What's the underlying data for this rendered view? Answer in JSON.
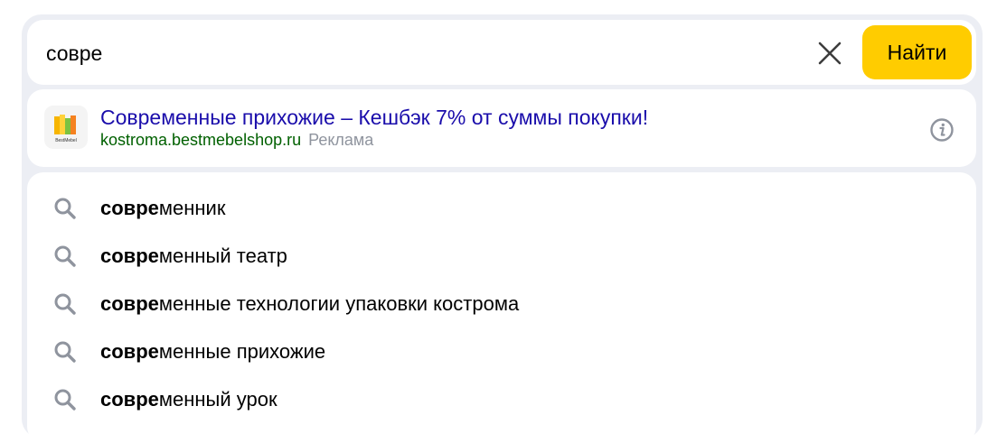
{
  "search": {
    "query": "совре",
    "submit_label": "Найти"
  },
  "ad": {
    "title": "Современные прихожие – Кешбэк 7% от суммы покупки!",
    "domain": "kostroma.bestmebelshop.ru",
    "label": "Реклама",
    "logo_text": "BestMebel"
  },
  "suggestions": [
    {
      "prefix": "совре",
      "rest": "менник"
    },
    {
      "prefix": "совре",
      "rest": "менный театр"
    },
    {
      "prefix": "совре",
      "rest": "менные технологии упаковки кострома"
    },
    {
      "prefix": "совре",
      "rest": "менные прихожие"
    },
    {
      "prefix": "совре",
      "rest": "менный урок"
    }
  ],
  "colors": {
    "accent": "#ffcc00",
    "link": "#1a0dab",
    "domain": "#006000",
    "muted": "#8f949e",
    "frame": "#eceef4"
  },
  "icons": {
    "clear": "close-icon",
    "info": "info-icon",
    "suggestion": "search-icon"
  }
}
